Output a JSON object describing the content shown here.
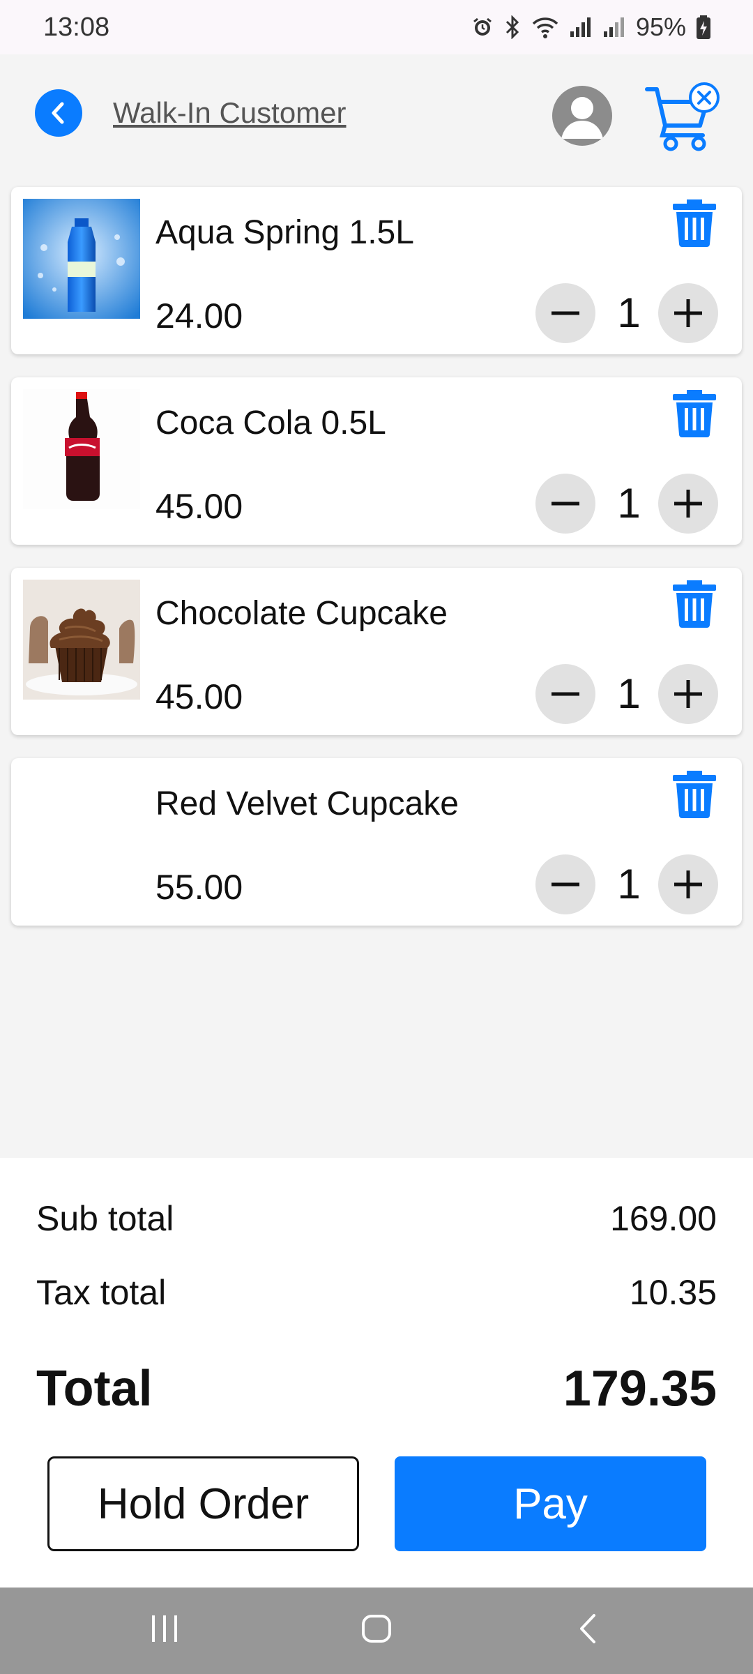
{
  "status_bar": {
    "time": "13:08",
    "battery": "95%",
    "icons": [
      "alarm-icon",
      "bluetooth-icon",
      "wifi-icon",
      "signal-icon",
      "signal-icon",
      "battery-charging-icon"
    ]
  },
  "header": {
    "customer": "Walk-In Customer",
    "back_icon": "chevron-left-icon",
    "avatar_icon": "user-avatar-icon",
    "cart_icon": "cart-clear-icon"
  },
  "cart": {
    "items": [
      {
        "name": "Aqua Spring 1.5L",
        "price": "24.00",
        "qty": "1",
        "image": "water-bottle"
      },
      {
        "name": "Coca Cola 0.5L",
        "price": "45.00",
        "qty": "1",
        "image": "cola-bottle"
      },
      {
        "name": "Chocolate Cupcake",
        "price": "45.00",
        "qty": "1",
        "image": "chocolate-cupcake"
      },
      {
        "name": "Red Velvet Cupcake",
        "price": "55.00",
        "qty": "1",
        "image": ""
      }
    ]
  },
  "summary": {
    "subtotal_label": "Sub total",
    "subtotal": "169.00",
    "tax_label": "Tax total",
    "tax": "10.35",
    "total_label": "Total",
    "total": "179.35"
  },
  "actions": {
    "hold": "Hold Order",
    "pay": "Pay"
  },
  "colors": {
    "accent": "#0a7cff",
    "background": "#f4f4f4",
    "nav_bar": "#979797"
  }
}
